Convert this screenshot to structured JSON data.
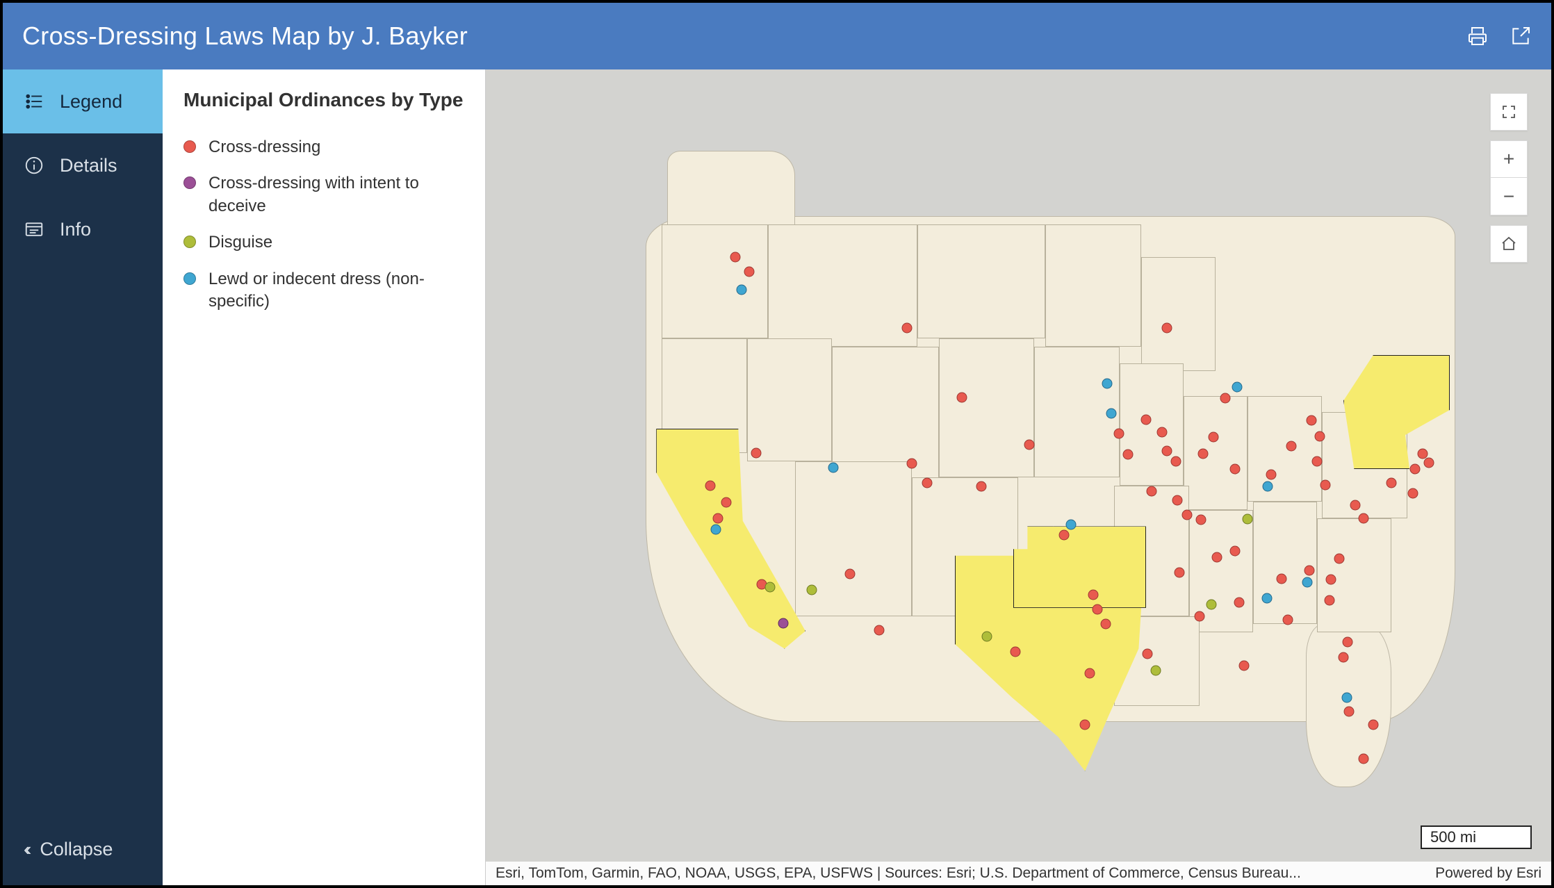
{
  "header": {
    "title": "Cross-Dressing Laws Map by J. Bayker"
  },
  "sidebar": {
    "items": [
      {
        "label": "Legend",
        "icon": "legend-icon"
      },
      {
        "label": "Details",
        "icon": "info-icon"
      },
      {
        "label": "Info",
        "icon": "panel-icon"
      }
    ],
    "collapse_label": "Collapse"
  },
  "panel": {
    "title": "Municipal Ordinances by Type",
    "legend": [
      {
        "color": "red",
        "label": "Cross-dressing"
      },
      {
        "color": "purple",
        "label": "Cross-dressing with intent to deceive"
      },
      {
        "color": "green",
        "label": "Disguise"
      },
      {
        "color": "blue",
        "label": "Lewd or indecent dress (non-specific)"
      }
    ]
  },
  "map": {
    "scale": "500 mi",
    "attribution_left": "Esri, TomTom, Garmin, FAO, NOAA, USGS, EPA, USFWS | Sources: Esri; U.S. Department of Commerce, Census Bureau...",
    "attribution_right": "Powered by Esri",
    "highlighted_states": [
      "California",
      "Texas",
      "Oklahoma",
      "New York"
    ],
    "markers": [
      {
        "t": "red",
        "x": 23.4,
        "y": 23.0
      },
      {
        "t": "blue",
        "x": 24.0,
        "y": 27.0
      },
      {
        "t": "red",
        "x": 24.7,
        "y": 24.8
      },
      {
        "t": "red",
        "x": 39.5,
        "y": 31.7
      },
      {
        "t": "red",
        "x": 21.1,
        "y": 51.0
      },
      {
        "t": "red",
        "x": 22.6,
        "y": 53.1
      },
      {
        "t": "red",
        "x": 21.8,
        "y": 55.0
      },
      {
        "t": "blue",
        "x": 21.6,
        "y": 56.4
      },
      {
        "t": "red",
        "x": 25.9,
        "y": 63.1
      },
      {
        "t": "green",
        "x": 26.7,
        "y": 63.5
      },
      {
        "t": "purple",
        "x": 27.9,
        "y": 67.9
      },
      {
        "t": "red",
        "x": 25.4,
        "y": 47.0
      },
      {
        "t": "green",
        "x": 30.6,
        "y": 63.8
      },
      {
        "t": "blue",
        "x": 32.6,
        "y": 48.8
      },
      {
        "t": "red",
        "x": 34.2,
        "y": 61.8
      },
      {
        "t": "red",
        "x": 36.9,
        "y": 68.7
      },
      {
        "t": "red",
        "x": 40.0,
        "y": 48.3
      },
      {
        "t": "red",
        "x": 41.4,
        "y": 50.7
      },
      {
        "t": "red",
        "x": 44.7,
        "y": 40.2
      },
      {
        "t": "red",
        "x": 46.5,
        "y": 51.1
      },
      {
        "t": "green",
        "x": 47.0,
        "y": 69.5
      },
      {
        "t": "red",
        "x": 49.7,
        "y": 71.4
      },
      {
        "t": "red",
        "x": 51.0,
        "y": 46.0
      },
      {
        "t": "red",
        "x": 54.3,
        "y": 57.1
      },
      {
        "t": "blue",
        "x": 54.9,
        "y": 55.8
      },
      {
        "t": "red",
        "x": 57.0,
        "y": 64.4
      },
      {
        "t": "red",
        "x": 57.4,
        "y": 66.2
      },
      {
        "t": "red",
        "x": 58.2,
        "y": 68.0
      },
      {
        "t": "red",
        "x": 56.7,
        "y": 74.0
      },
      {
        "t": "red",
        "x": 56.2,
        "y": 80.3
      },
      {
        "t": "red",
        "x": 62.1,
        "y": 71.6
      },
      {
        "t": "green",
        "x": 62.9,
        "y": 73.7
      },
      {
        "t": "red",
        "x": 65.1,
        "y": 61.7
      },
      {
        "t": "red",
        "x": 63.9,
        "y": 31.7
      },
      {
        "t": "red",
        "x": 60.3,
        "y": 47.2
      },
      {
        "t": "blue",
        "x": 58.3,
        "y": 38.5
      },
      {
        "t": "blue",
        "x": 58.7,
        "y": 42.2
      },
      {
        "t": "red",
        "x": 59.4,
        "y": 44.6
      },
      {
        "t": "red",
        "x": 62.0,
        "y": 42.9
      },
      {
        "t": "red",
        "x": 63.5,
        "y": 44.5
      },
      {
        "t": "red",
        "x": 63.9,
        "y": 46.8
      },
      {
        "t": "red",
        "x": 64.8,
        "y": 48.0
      },
      {
        "t": "red",
        "x": 62.5,
        "y": 51.7
      },
      {
        "t": "red",
        "x": 64.9,
        "y": 52.8
      },
      {
        "t": "red",
        "x": 65.8,
        "y": 54.6
      },
      {
        "t": "red",
        "x": 67.1,
        "y": 55.2
      },
      {
        "t": "red",
        "x": 67.3,
        "y": 47.1
      },
      {
        "t": "red",
        "x": 68.3,
        "y": 45.1
      },
      {
        "t": "red",
        "x": 70.3,
        "y": 49.0
      },
      {
        "t": "green",
        "x": 71.5,
        "y": 55.1
      },
      {
        "t": "red",
        "x": 73.7,
        "y": 49.7
      },
      {
        "t": "blue",
        "x": 73.4,
        "y": 51.1
      },
      {
        "t": "red",
        "x": 68.6,
        "y": 59.8
      },
      {
        "t": "red",
        "x": 70.3,
        "y": 59.0
      },
      {
        "t": "red",
        "x": 71.2,
        "y": 73.1
      },
      {
        "t": "red",
        "x": 67.0,
        "y": 67.0
      },
      {
        "t": "green",
        "x": 68.1,
        "y": 65.6
      },
      {
        "t": "red",
        "x": 70.7,
        "y": 65.3
      },
      {
        "t": "blue",
        "x": 73.3,
        "y": 64.8
      },
      {
        "t": "red",
        "x": 75.3,
        "y": 67.5
      },
      {
        "t": "red",
        "x": 74.7,
        "y": 62.4
      },
      {
        "t": "red",
        "x": 77.3,
        "y": 61.4
      },
      {
        "t": "blue",
        "x": 77.1,
        "y": 62.9
      },
      {
        "t": "red",
        "x": 79.3,
        "y": 62.5
      },
      {
        "t": "red",
        "x": 79.2,
        "y": 65.1
      },
      {
        "t": "red",
        "x": 80.1,
        "y": 60.0
      },
      {
        "t": "red",
        "x": 81.6,
        "y": 53.4
      },
      {
        "t": "red",
        "x": 82.4,
        "y": 55.0
      },
      {
        "t": "red",
        "x": 78.8,
        "y": 50.9
      },
      {
        "t": "red",
        "x": 78.0,
        "y": 48.0
      },
      {
        "t": "red",
        "x": 75.6,
        "y": 46.2
      },
      {
        "t": "red",
        "x": 78.3,
        "y": 45.0
      },
      {
        "t": "red",
        "x": 69.4,
        "y": 40.3
      },
      {
        "t": "blue",
        "x": 70.5,
        "y": 38.9
      },
      {
        "t": "red",
        "x": 77.5,
        "y": 43.0
      },
      {
        "t": "red",
        "x": 85.0,
        "y": 50.7
      },
      {
        "t": "red",
        "x": 87.2,
        "y": 49.0
      },
      {
        "t": "red",
        "x": 88.5,
        "y": 48.2
      },
      {
        "t": "red",
        "x": 87.0,
        "y": 52.0
      },
      {
        "t": "red",
        "x": 80.9,
        "y": 70.2
      },
      {
        "t": "red",
        "x": 80.5,
        "y": 72.1
      },
      {
        "t": "blue",
        "x": 80.8,
        "y": 77.0
      },
      {
        "t": "red",
        "x": 81.0,
        "y": 78.7
      },
      {
        "t": "red",
        "x": 83.3,
        "y": 80.3
      },
      {
        "t": "red",
        "x": 82.4,
        "y": 84.5
      },
      {
        "t": "red",
        "x": 87.9,
        "y": 47.1
      }
    ]
  }
}
